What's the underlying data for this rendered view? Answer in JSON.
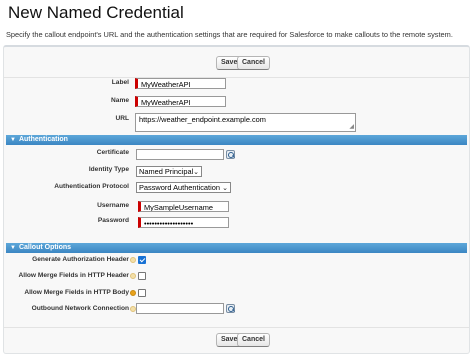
{
  "page": {
    "title": "New Named Credential",
    "description": "Specify the callout endpoint's URL and the authentication settings that are required for Salesforce to make callouts to the remote system."
  },
  "buttons": {
    "save": "Save",
    "cancel": "Cancel"
  },
  "details": {
    "label": {
      "label": "Label",
      "value": "MyWeatherAPI"
    },
    "name": {
      "label": "Name",
      "value": "MyWeatherAPI"
    },
    "url": {
      "label": "URL",
      "value": "https://weather_endpoint.example.com"
    }
  },
  "authentication": {
    "heading": "Authentication",
    "certificate": {
      "label": "Certificate",
      "value": ""
    },
    "identity_type": {
      "label": "Identity Type",
      "value": "Named Principal"
    },
    "auth_protocol": {
      "label": "Authentication Protocol",
      "value": "Password Authentication"
    },
    "username": {
      "label": "Username",
      "value": "MySampleUsername"
    },
    "password": {
      "label": "Password",
      "value": "•••••••••••••••••••"
    }
  },
  "callout_options": {
    "heading": "Callout Options",
    "generate_auth_header": {
      "label": "Generate Authorization Header",
      "checked": true
    },
    "merge_fields_header": {
      "label": "Allow Merge Fields in HTTP Header",
      "checked": false
    },
    "merge_fields_body": {
      "label": "Allow Merge Fields in HTTP Body",
      "checked": false
    },
    "outbound_network": {
      "label": "Outbound Network Connection",
      "value": ""
    }
  },
  "icons": {
    "collapse": "triangle-down-icon",
    "lookup": "magnifier-icon",
    "help": "info-bubble-icon"
  },
  "colors": {
    "section_header": "#3b86c3",
    "required_bar": "#cc0000",
    "checkbox_checked": "#1872d4",
    "help_active": "#e8a21a"
  }
}
